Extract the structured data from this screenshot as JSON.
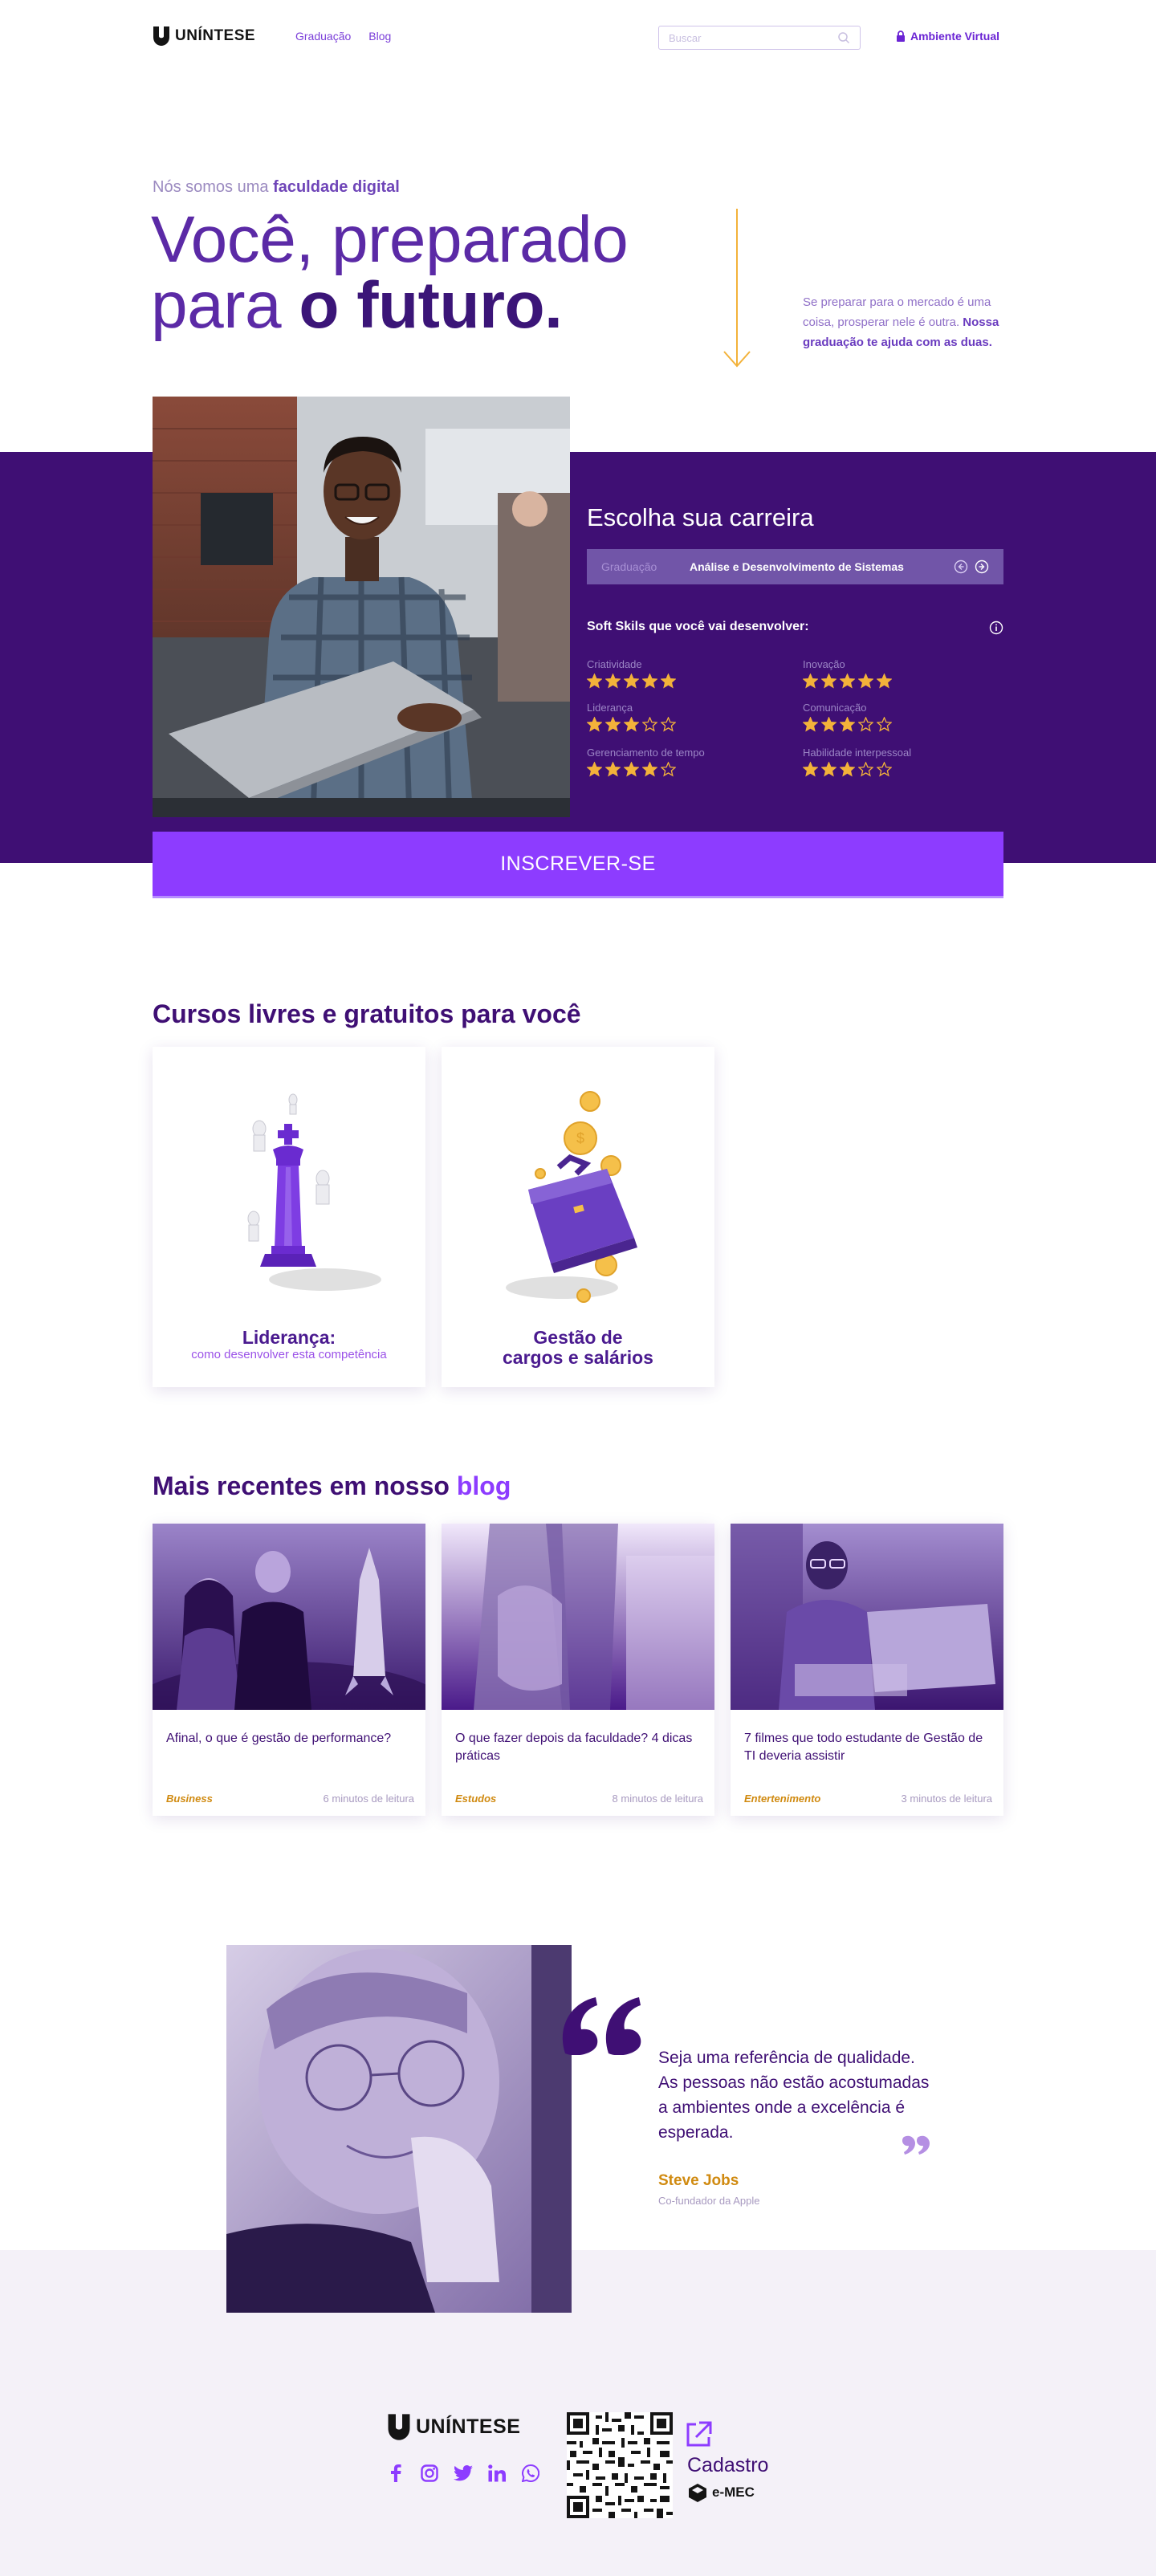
{
  "header": {
    "logo_text": "UNÍNTESE",
    "nav": [
      "Graduação",
      "Blog"
    ],
    "search_placeholder": "Buscar",
    "virtual_label": "Ambiente Virtual"
  },
  "hero": {
    "eyebrow_prefix": "Nós somos uma ",
    "eyebrow_bold": "faculdade digital",
    "title_line1": "Você, preparado",
    "title_line2_prefix": "para ",
    "title_line2_bold": "o futuro.",
    "tagline_prefix": "Se preparar para o mercado é uma coisa, prosperar nele é outra. ",
    "tagline_bold": "Nossa graduação te ajuda com as duas."
  },
  "career": {
    "title": "Escolha sua carreira",
    "select_label": "Graduação",
    "select_value": "Análise e Desenvolvimento de Sistemas",
    "softskills_title": "Soft Skils que você vai desenvolver:",
    "skills": [
      {
        "name": "Criatividade",
        "rating": 5
      },
      {
        "name": "Inovação",
        "rating": 5
      },
      {
        "name": "Liderança",
        "rating": 3
      },
      {
        "name": "Comunicação",
        "rating": 3
      },
      {
        "name": "Gerenciamento de tempo",
        "rating": 4
      },
      {
        "name": "Habilidade interpessoal",
        "rating": 3
      }
    ],
    "max_rating": 5,
    "star_color": "#f3b23a",
    "cta_label": "INSCREVER-SE"
  },
  "courses": {
    "title_prefix": "Cursos ",
    "title_bold": "livres e gratuitos",
    "title_suffix": " para você",
    "items": [
      {
        "title": "Liderança:",
        "subtitle": "como desenvolver esta competência",
        "icon": "chess-king-icon"
      },
      {
        "title_line1": "Gestão de",
        "title_line2": "cargos e salários",
        "icon": "briefcase-coins-icon"
      }
    ]
  },
  "blog": {
    "title_prefix": "Mais recentes em nosso ",
    "title_highlight": "blog",
    "posts": [
      {
        "title": "Afinal, o que é gestão de performance?",
        "category": "Business",
        "read_time": "6 minutos de leitura"
      },
      {
        "title": "O que fazer depois da faculdade? 4 dicas práticas",
        "category": "Estudos",
        "read_time": "8 minutos de leitura"
      },
      {
        "title": "7 filmes que todo estudante de Gestão de TI deveria assistir",
        "category": "Entertenimento",
        "read_time": "3 minutos de leitura"
      }
    ]
  },
  "quote": {
    "text": "Seja uma referência de qualidade. As pessoas não estão acostumadas a ambientes onde a excelência é esperada.",
    "author": "Steve Jobs",
    "role": "Co-fundador da Apple"
  },
  "footer": {
    "logo_text": "UNÍNTESE",
    "socials": [
      "facebook-icon",
      "instagram-icon",
      "twitter-icon",
      "linkedin-icon",
      "whatsapp-icon"
    ],
    "cadastro_label": "Cadastro",
    "emec_label": "e-MEC"
  },
  "colors": {
    "brand_dark": "#3f0f74",
    "brand_accent": "#8d3cff",
    "gold": "#d08a10"
  }
}
